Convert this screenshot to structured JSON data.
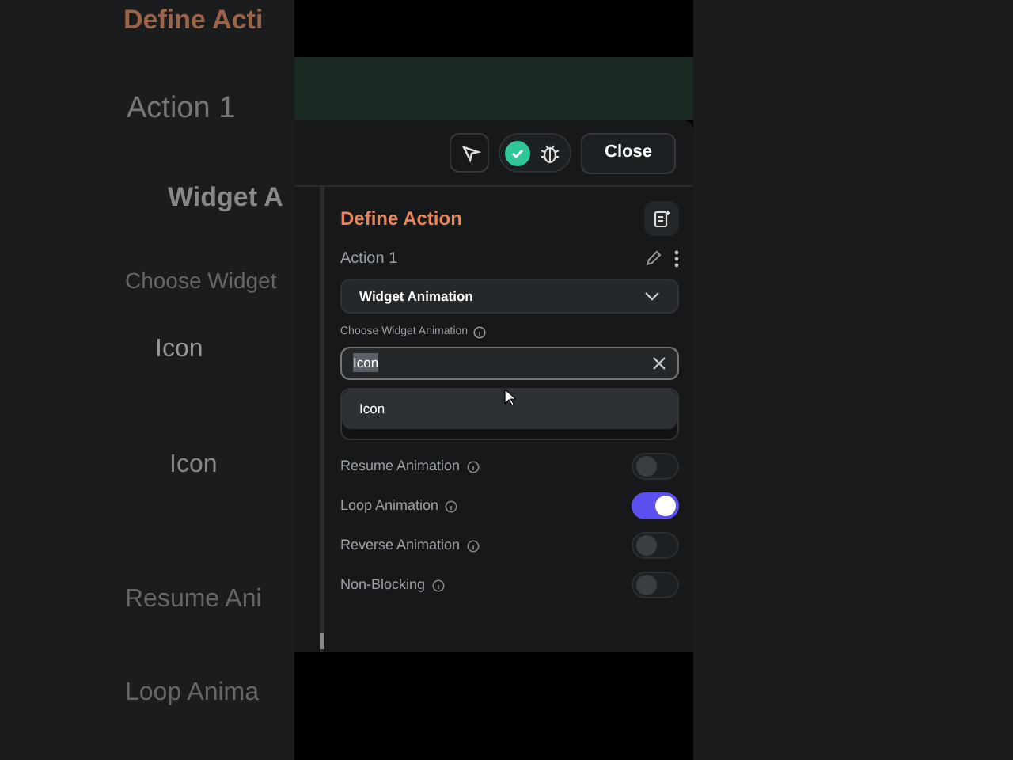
{
  "backdrop": {
    "texts": [
      "Define Acti",
      "Action 1",
      "Widget A",
      "Choose Widget",
      "Icon",
      "Icon",
      "Resume Ani",
      "Loop Anima"
    ]
  },
  "toolbar": {
    "close_label": "Close",
    "check_ok": true
  },
  "panel": {
    "title": "Define Action",
    "action_label": "Action 1",
    "action_type": "Widget Animation",
    "choose_label": "Choose Widget Animation",
    "field_value": "Icon",
    "options": [
      {
        "label": "Icon",
        "selected": true
      }
    ],
    "toggles": [
      {
        "label": "Resume Animation",
        "on": false
      },
      {
        "label": "Loop Animation",
        "on": true
      },
      {
        "label": "Reverse Animation",
        "on": false
      },
      {
        "label": "Non-Blocking",
        "on": false
      }
    ]
  }
}
